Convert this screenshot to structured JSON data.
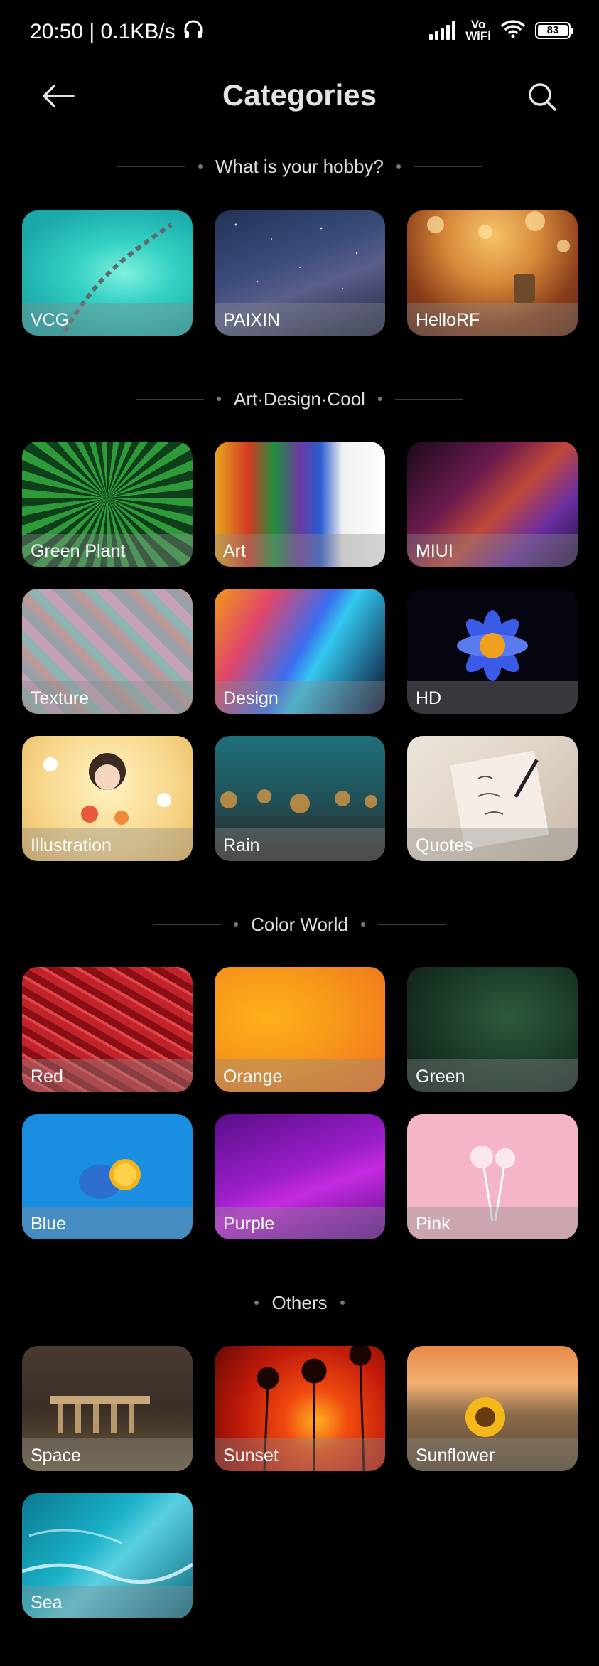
{
  "status_bar": {
    "time_speed": "20:50 | 0.1KB/s",
    "vowifi_top": "Vo",
    "vowifi_bottom": "WiFi",
    "battery": "83"
  },
  "header": {
    "title": "Categories"
  },
  "sections": [
    {
      "title": "What is your hobby?",
      "items": [
        {
          "label": "VCG"
        },
        {
          "label": "PAIXIN"
        },
        {
          "label": "HelloRF"
        }
      ]
    },
    {
      "title": "Art·Design·Cool",
      "items": [
        {
          "label": "Green Plant"
        },
        {
          "label": "Art"
        },
        {
          "label": "MIUI"
        },
        {
          "label": "Texture"
        },
        {
          "label": "Design"
        },
        {
          "label": "HD"
        },
        {
          "label": "Illustration"
        },
        {
          "label": "Rain"
        },
        {
          "label": "Quotes"
        }
      ]
    },
    {
      "title": "Color World",
      "items": [
        {
          "label": "Red"
        },
        {
          "label": "Orange"
        },
        {
          "label": "Green"
        },
        {
          "label": "Blue"
        },
        {
          "label": "Purple"
        },
        {
          "label": "Pink"
        }
      ]
    },
    {
      "title": "Others",
      "items": [
        {
          "label": "Space"
        },
        {
          "label": "Sunset"
        },
        {
          "label": "Sunflower"
        },
        {
          "label": "Sea"
        }
      ]
    }
  ]
}
